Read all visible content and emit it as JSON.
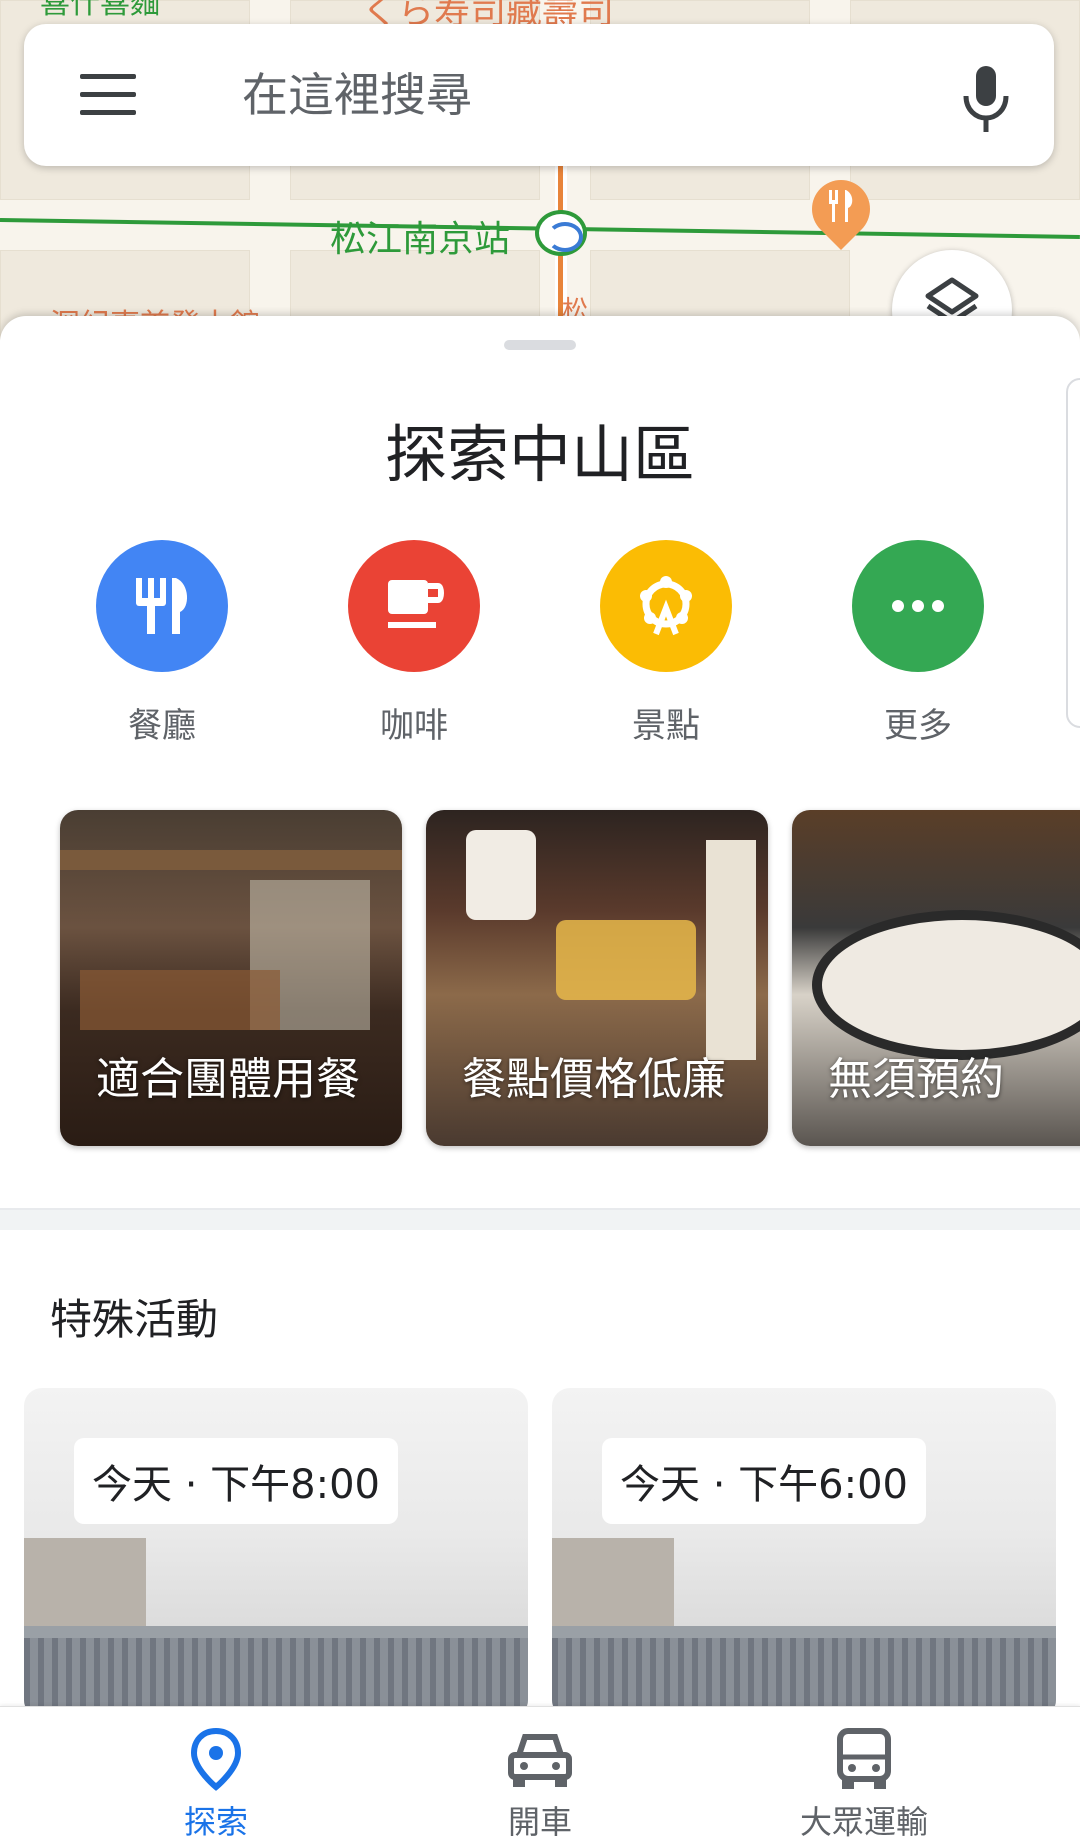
{
  "map": {
    "labels": {
      "top_left_cut": "喜什喜麵",
      "top_center_cut": "くら寿司藏壽司",
      "station": "松江南京站",
      "bottom_left_cut": "深紀事首發本館",
      "road_vertical": "松"
    },
    "line_colors": {
      "green_line": "#2e9a3a",
      "orange_line": "#e8843a"
    },
    "pin": {
      "icon": "restaurant-icon",
      "color": "#f39c54"
    },
    "layers_button": {
      "icon": "layers-icon"
    }
  },
  "search": {
    "placeholder": "在這裡搜尋",
    "menu_icon": "menu-icon",
    "mic_icon": "mic-icon"
  },
  "sheet": {
    "title": "探索中山區",
    "categories": [
      {
        "label": "餐廳",
        "icon": "restaurant-icon",
        "color": "#4285f4"
      },
      {
        "label": "咖啡",
        "icon": "coffee-icon",
        "color": "#ea4335"
      },
      {
        "label": "景點",
        "icon": "attraction-icon",
        "color": "#fbbc04"
      },
      {
        "label": "更多",
        "icon": "more-icon",
        "color": "#34a853"
      }
    ],
    "cards": [
      {
        "label": "適合團體用餐"
      },
      {
        "label": "餐點價格低廉"
      },
      {
        "label": "無須預約"
      }
    ],
    "events_title": "特殊活動",
    "events": [
      {
        "time": "今天 · 下午8:00"
      },
      {
        "time": "今天 · 下午6:00"
      }
    ]
  },
  "nav": {
    "items": [
      {
        "label": "探索",
        "icon": "explore-pin-icon",
        "active": true
      },
      {
        "label": "開車",
        "icon": "car-icon",
        "active": false
      },
      {
        "label": "大眾運輸",
        "icon": "bus-icon",
        "active": false
      }
    ],
    "active_color": "#1a73e8"
  }
}
